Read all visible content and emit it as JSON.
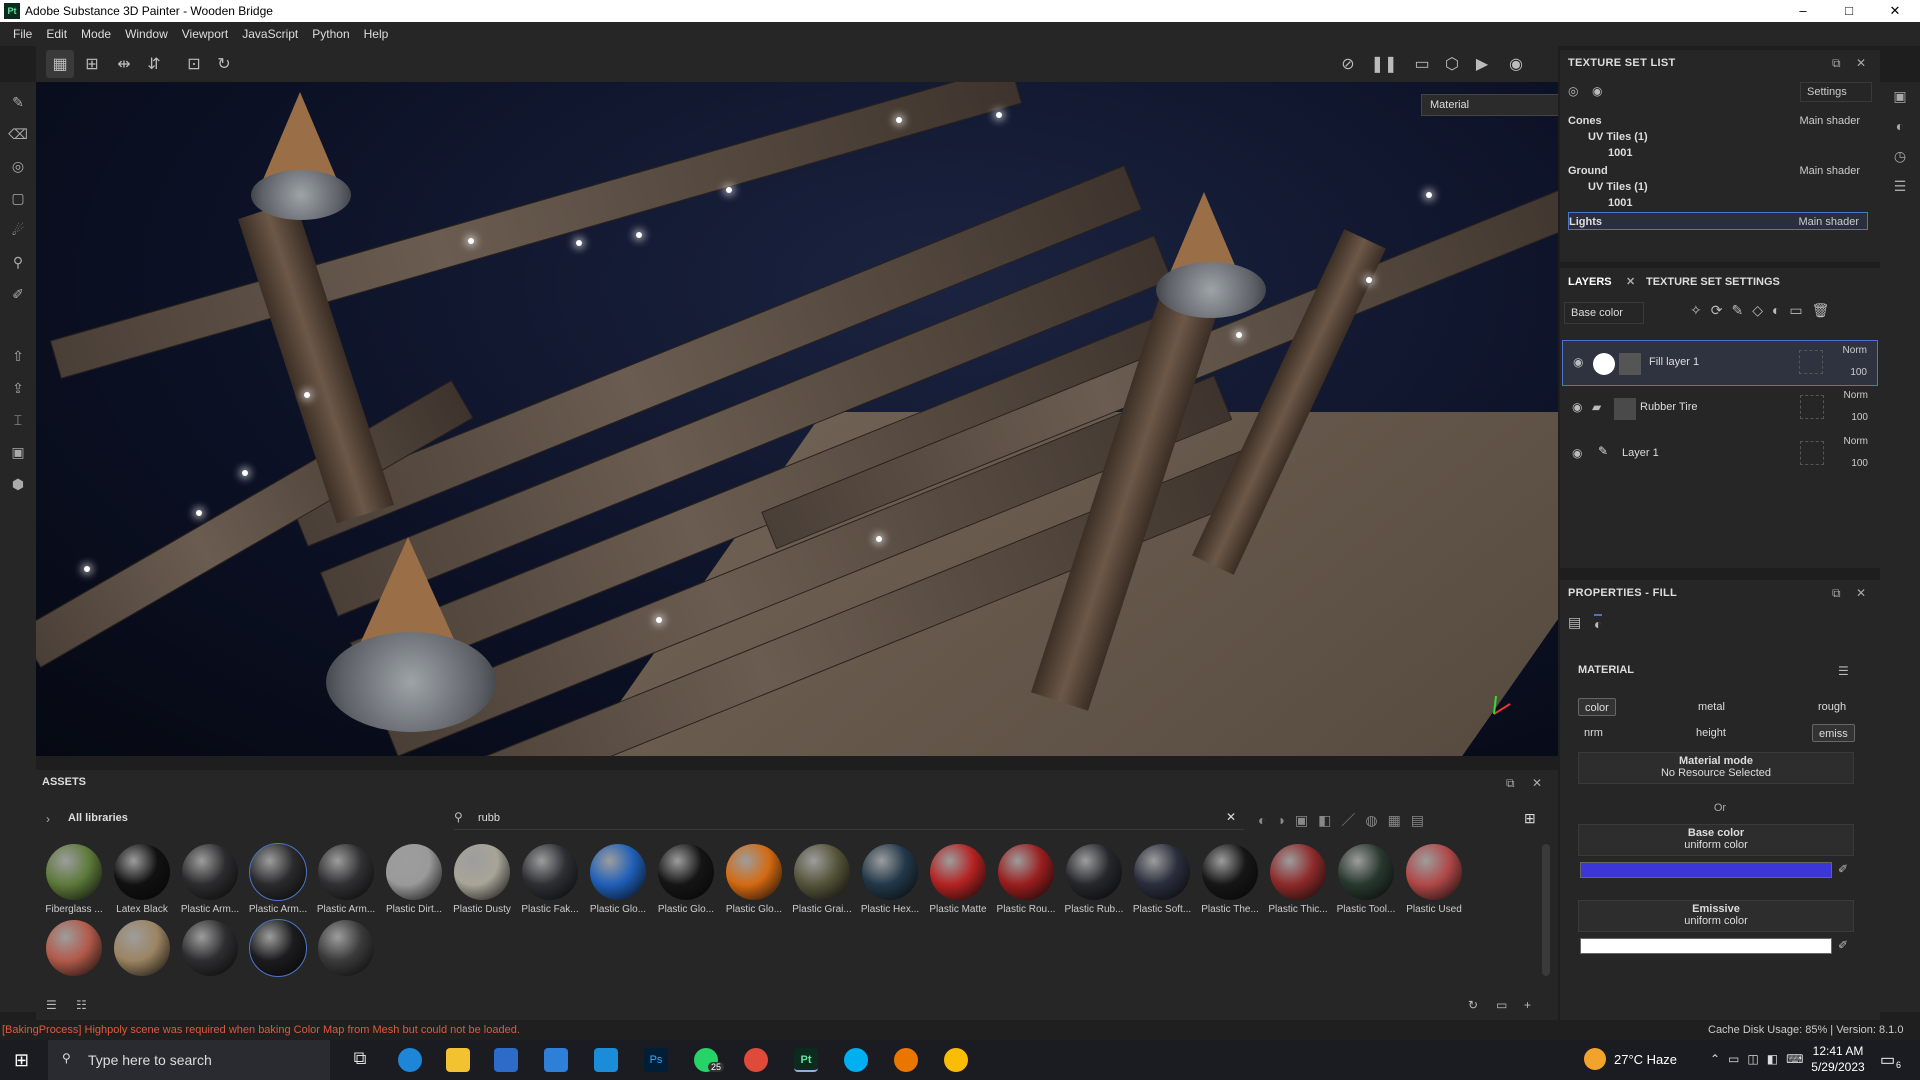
{
  "window": {
    "title": "Adobe Substance 3D Painter - Wooden Bridge",
    "app_badge": "Pt",
    "minimize": "–",
    "maximize": "□",
    "close": "✕"
  },
  "menu": [
    "File",
    "Edit",
    "Mode",
    "Window",
    "Viewport",
    "JavaScript",
    "Python",
    "Help"
  ],
  "viewport": {
    "channel_select": "Material"
  },
  "texture_set_list": {
    "title": "TEXTURE SET LIST",
    "settings_label": "Settings",
    "rows": [
      {
        "name": "Cones",
        "shader": "Main shader"
      },
      {
        "name": "UV Tiles (1)"
      },
      {
        "name": "1001"
      },
      {
        "name": "Ground",
        "shader": "Main shader"
      },
      {
        "name": "UV Tiles (1)"
      },
      {
        "name": "1001"
      },
      {
        "name": "Lights",
        "shader": "Main shader"
      }
    ]
  },
  "layers": {
    "tab_layers": "LAYERS",
    "tab_settings": "TEXTURE SET SETTINGS",
    "channel": "Base color",
    "items": [
      {
        "name": "Fill layer 1",
        "blend": "Norm",
        "opacity": "100"
      },
      {
        "name": "Rubber Tire",
        "blend": "Norm",
        "opacity": "100"
      },
      {
        "name": "Layer 1",
        "blend": "Norm",
        "opacity": "100"
      }
    ]
  },
  "properties": {
    "title": "PROPERTIES - FILL",
    "section": "MATERIAL",
    "chips": [
      "color",
      "metal",
      "rough",
      "nrm",
      "height",
      "emiss"
    ],
    "material_mode_label": "Material mode",
    "material_mode_value": "No Resource Selected",
    "or": "Or",
    "base_color_label": "Base color",
    "base_color_sub": "uniform color",
    "base_color_hex": "#3a36d8",
    "emissive_label": "Emissive",
    "emissive_sub": "uniform color",
    "emissive_hex": "#ffffff"
  },
  "assets": {
    "title": "ASSETS",
    "library": "All libraries",
    "search": "rubb",
    "items": [
      {
        "label": "Fiberglass ...",
        "color": "#5d7a3a"
      },
      {
        "label": "Latex Black",
        "color": "#111111"
      },
      {
        "label": "Plastic Arm...",
        "color": "#2c2c2e"
      },
      {
        "label": "Plastic Arm...",
        "color": "#2a2a2c"
      },
      {
        "label": "Plastic Arm...",
        "color": "#303032"
      },
      {
        "label": "Plastic Dirt...",
        "color": "#9a9a9a"
      },
      {
        "label": "Plastic Dusty",
        "color": "#a8a498"
      },
      {
        "label": "Plastic Fak...",
        "color": "#2d2f34"
      },
      {
        "label": "Plastic Glo...",
        "color": "#1f5fb8"
      },
      {
        "label": "Plastic Glo...",
        "color": "#151515"
      },
      {
        "label": "Plastic Glo...",
        "color": "#d46a12"
      },
      {
        "label": "Plastic Grai...",
        "color": "#54543a"
      },
      {
        "label": "Plastic Hex...",
        "color": "#22384a"
      },
      {
        "label": "Plastic Matte",
        "color": "#b42222"
      },
      {
        "label": "Plastic Rou...",
        "color": "#9a1e1e"
      },
      {
        "label": "Plastic Rub...",
        "color": "#26272b"
      },
      {
        "label": "Plastic Soft...",
        "color": "#2a2d3c"
      },
      {
        "label": "Plastic The...",
        "color": "#161616"
      },
      {
        "label": "Plastic Thic...",
        "color": "#8e2a2a"
      },
      {
        "label": "Plastic Tool...",
        "color": "#28382e"
      },
      {
        "label": "Plastic Used",
        "color": "#b04848"
      },
      {
        "label": "",
        "color": "#b25a4a"
      },
      {
        "label": "",
        "color": "#9c8462"
      },
      {
        "label": "",
        "color": "#2e2e30"
      },
      {
        "label": "",
        "color": "#1c1c1e"
      },
      {
        "label": "",
        "color": "#3a3a3a"
      }
    ]
  },
  "status": {
    "message": "[BakingProcess] Highpoly scene was required when baking Color Map from Mesh but could not be loaded.",
    "cache": "Cache Disk Usage:  85% | Version: 8.1.0"
  },
  "taskbar": {
    "search_placeholder": "Type here to search",
    "weather": "27°C  Haze",
    "time": "12:41 AM",
    "date": "5/29/2023",
    "notif_count": "6",
    "whatsapp_badge": "25"
  }
}
